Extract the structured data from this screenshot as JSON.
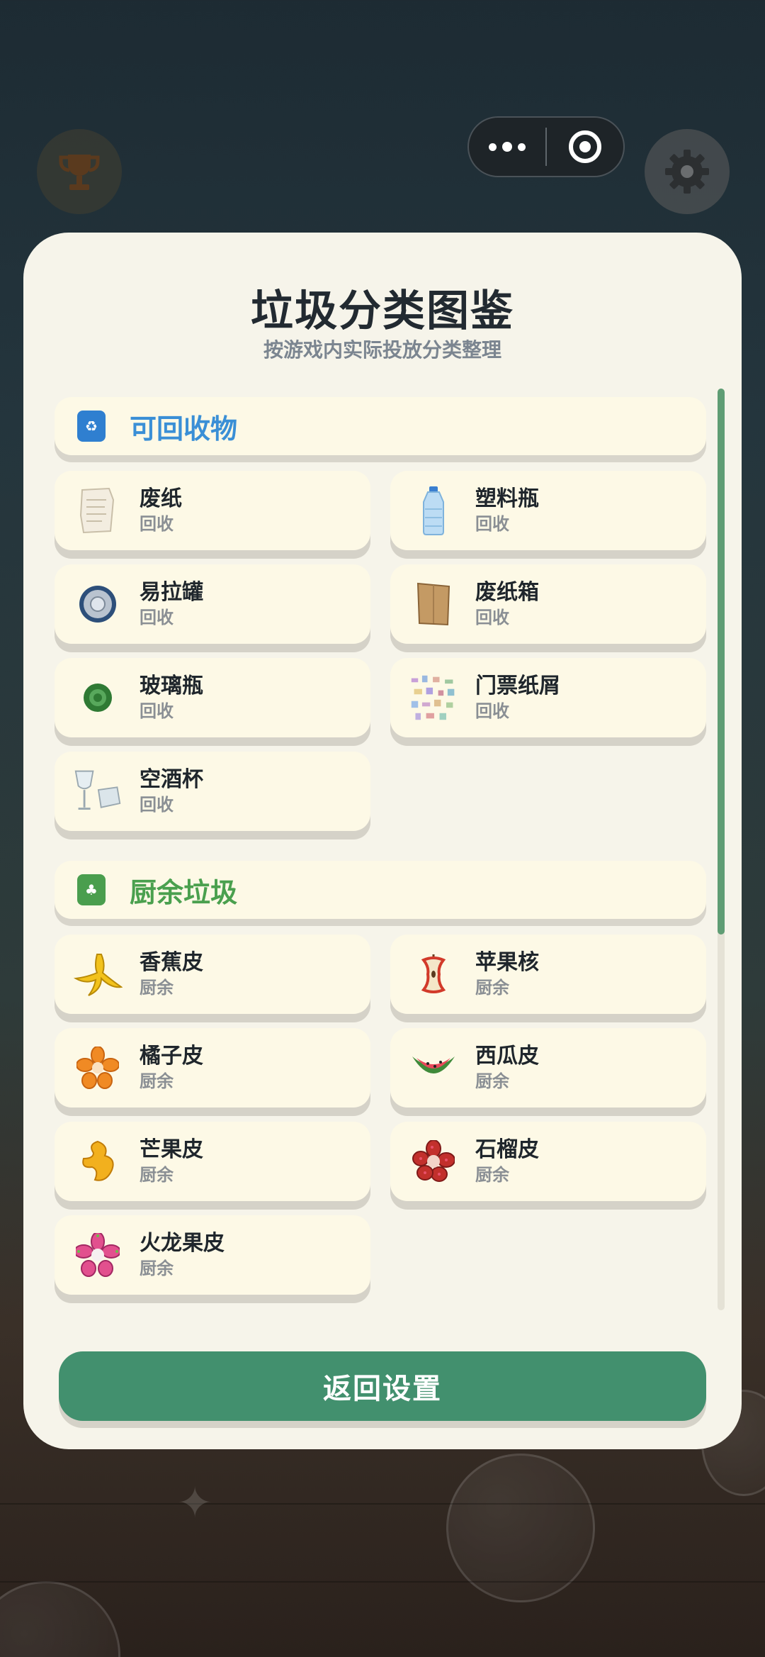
{
  "header": {
    "trophy_icon": "trophy-icon",
    "settings_icon": "gear-icon",
    "capsule": {
      "more_icon": "more-dots-icon",
      "close_icon": "target-icon"
    }
  },
  "panel": {
    "title": "垃圾分类图鉴",
    "subtitle": "按游戏内实际投放分类整理",
    "sections": [
      {
        "title": "可回收物",
        "color": "#3a8fd6",
        "icon": "recycle-bin-icon",
        "items": [
          {
            "name": "废纸",
            "category": "回收",
            "icon": "waste-paper-icon"
          },
          {
            "name": "塑料瓶",
            "category": "回收",
            "icon": "plastic-bottle-icon"
          },
          {
            "name": "易拉罐",
            "category": "回收",
            "icon": "can-icon"
          },
          {
            "name": "废纸箱",
            "category": "回收",
            "icon": "cardboard-box-icon"
          },
          {
            "name": "玻璃瓶",
            "category": "回收",
            "icon": "glass-bottle-icon"
          },
          {
            "name": "门票纸屑",
            "category": "回收",
            "icon": "ticket-scraps-icon"
          },
          {
            "name": "空酒杯",
            "category": "回收",
            "icon": "wine-glass-icon"
          }
        ]
      },
      {
        "title": "厨余垃圾",
        "color": "#4aa04e",
        "icon": "kitchen-bin-icon",
        "items": [
          {
            "name": "香蕉皮",
            "category": "厨余",
            "icon": "banana-peel-icon"
          },
          {
            "name": "苹果核",
            "category": "厨余",
            "icon": "apple-core-icon"
          },
          {
            "name": "橘子皮",
            "category": "厨余",
            "icon": "orange-peel-icon"
          },
          {
            "name": "西瓜皮",
            "category": "厨余",
            "icon": "watermelon-rind-icon"
          },
          {
            "name": "芒果皮",
            "category": "厨余",
            "icon": "mango-peel-icon"
          },
          {
            "name": "石榴皮",
            "category": "厨余",
            "icon": "pomegranate-peel-icon"
          },
          {
            "name": "火龙果皮",
            "category": "厨余",
            "icon": "dragon-fruit-peel-icon"
          }
        ]
      }
    ],
    "back_button": "返回设置"
  },
  "colors": {
    "accent_green": "#42906e",
    "panel_bg": "#f6f4ea",
    "card_bg": "#fdf9e6"
  }
}
